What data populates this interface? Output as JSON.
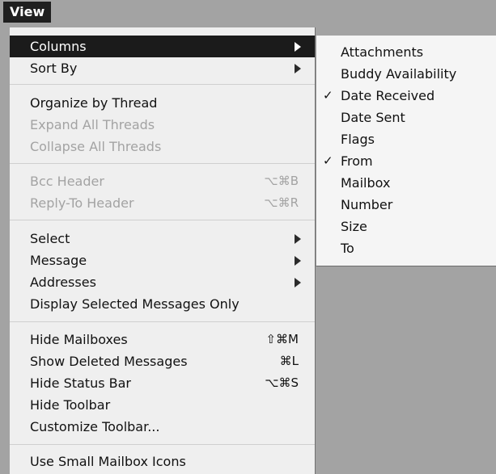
{
  "menubar": {
    "title": "View"
  },
  "menu": {
    "items": [
      {
        "label": "Columns",
        "arrow": true,
        "highlight": true
      },
      {
        "label": "Sort By",
        "arrow": true
      },
      {
        "label": "Organize by Thread"
      },
      {
        "label": "Expand All Threads",
        "disabled": true
      },
      {
        "label": "Collapse All Threads",
        "disabled": true
      },
      {
        "label": "Bcc Header",
        "shortcut": "⌥⌘B",
        "disabled": true
      },
      {
        "label": "Reply-To Header",
        "shortcut": "⌥⌘R",
        "disabled": true
      },
      {
        "label": "Select",
        "arrow": true
      },
      {
        "label": "Message",
        "arrow": true
      },
      {
        "label": "Addresses",
        "arrow": true
      },
      {
        "label": "Display Selected Messages Only"
      },
      {
        "label": "Hide Mailboxes",
        "shortcut": "⇧⌘M"
      },
      {
        "label": "Show Deleted Messages",
        "shortcut": "⌘L"
      },
      {
        "label": "Hide Status Bar",
        "shortcut": "⌥⌘S"
      },
      {
        "label": "Hide Toolbar"
      },
      {
        "label": "Customize Toolbar..."
      },
      {
        "label": "Use Small Mailbox Icons"
      }
    ]
  },
  "submenu": {
    "items": [
      {
        "label": "Attachments",
        "checked": false
      },
      {
        "label": "Buddy Availability",
        "checked": false
      },
      {
        "label": "Date Received",
        "checked": true
      },
      {
        "label": "Date Sent",
        "checked": false
      },
      {
        "label": "Flags",
        "checked": false
      },
      {
        "label": "From",
        "checked": true
      },
      {
        "label": "Mailbox",
        "checked": false
      },
      {
        "label": "Number",
        "checked": false
      },
      {
        "label": "Size",
        "checked": false
      },
      {
        "label": "To",
        "checked": false
      }
    ],
    "check_glyph": "✓"
  }
}
